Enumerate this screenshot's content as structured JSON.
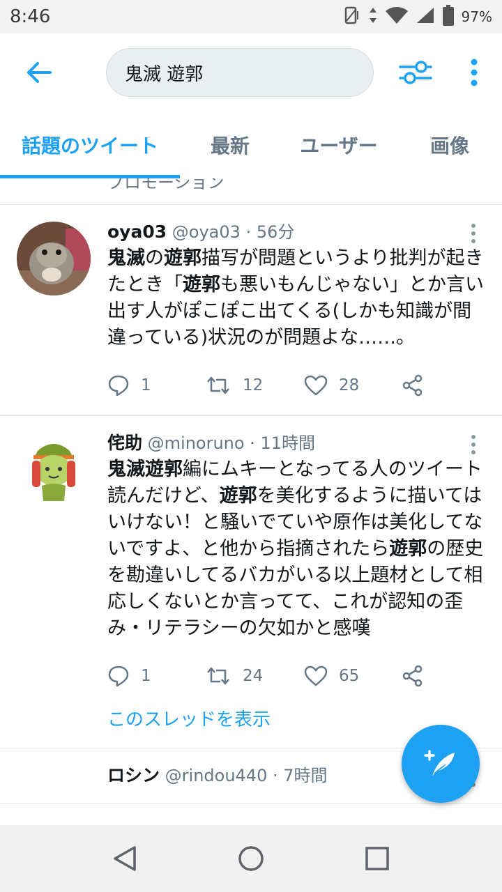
{
  "status": {
    "time": "8:46",
    "battery": "97%"
  },
  "search": {
    "query": "鬼滅 遊郭"
  },
  "tabs": [
    {
      "label": "話題のツイート",
      "active": true
    },
    {
      "label": "最新"
    },
    {
      "label": "ユーザー"
    },
    {
      "label": "画像"
    }
  ],
  "cut_top_text": "プロモーション",
  "tweets": [
    {
      "name": "oya03",
      "handle": "@oya03",
      "time": "56分",
      "body_html": "<b>鬼滅</b>の<b>遊郭</b>描写が問題というより批判が起きたとき「<b>遊郭</b>も悪いもんじゃない」とか言い出す人がぽこぽこ出てくる(しかも知識が間違っている)状況のが問題よな……。",
      "replies": "1",
      "retweets": "12",
      "likes": "28"
    },
    {
      "name": "侘助",
      "handle": "@minoruno",
      "time": "11時間",
      "body_html": "<b>鬼滅遊郭</b>編にムキーとなってる人のツイート読んだけど、<b>遊郭</b>を美化するように描いてはいけない！と騒いでていや原作は美化してないですよ、と他から指摘されたら<b>遊郭</b>の歴史を勘違いしてるバカがいる以上題材として相応しくないとか言ってて、これが認知の歪み・リテラシーの欠如かと感嘆",
      "replies": "1",
      "retweets": "24",
      "likes": "65",
      "thread_link": "このスレッドを表示"
    },
    {
      "name": "ロシン",
      "handle": "@rindou440",
      "time": "7時間"
    }
  ],
  "colors": {
    "accent": "#1da1f2",
    "muted": "#657786",
    "divider": "#e1e8ed"
  }
}
